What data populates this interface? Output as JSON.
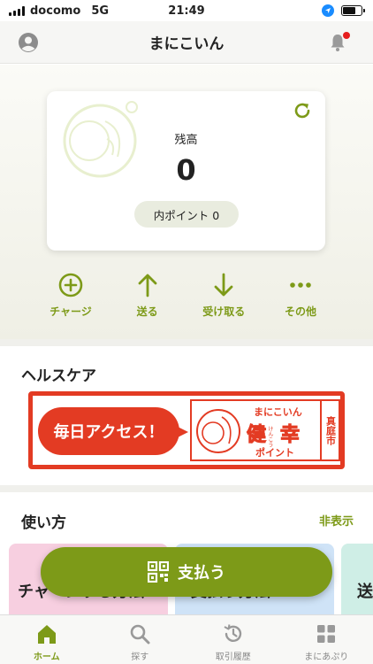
{
  "status_bar": {
    "carrier": "docomo",
    "network": "5G",
    "time": "21:49"
  },
  "header": {
    "title": "まにこいん"
  },
  "balance": {
    "label": "残高",
    "value": "0",
    "points_text": "内ポイント 0"
  },
  "actions": [
    {
      "label": "チャージ",
      "icon": "plus-circle-icon"
    },
    {
      "label": "送る",
      "icon": "arrow-up-icon"
    },
    {
      "label": "受け取る",
      "icon": "arrow-down-icon"
    },
    {
      "label": "その他",
      "icon": "more-dots-icon"
    }
  ],
  "health": {
    "title": "ヘルスケア",
    "banner": {
      "bubble_text": "毎日アクセス！",
      "logo_title": "まにこいん",
      "logo_main_1": "健",
      "logo_main_2": "幸",
      "logo_ruby_1": "けんこう",
      "logo_sub": "ポイント",
      "logo_city": "真庭市"
    }
  },
  "howto": {
    "title": "使い方",
    "hide_label": "非表示",
    "cards": [
      {
        "text": "チャージする方法",
        "color": "#f7cfe0"
      },
      {
        "text": "支払う方法",
        "color": "#cfe3f7"
      },
      {
        "text": "送る方法",
        "color": "#cfeee6"
      }
    ]
  },
  "pay_button": {
    "label": "支払う"
  },
  "tabs": [
    {
      "label": "ホーム",
      "icon": "home-icon",
      "active": true
    },
    {
      "label": "探す",
      "icon": "search-icon",
      "active": false
    },
    {
      "label": "取引履歴",
      "icon": "history-icon",
      "active": false
    },
    {
      "label": "まにあぷり",
      "icon": "apps-icon",
      "active": false
    }
  ],
  "colors": {
    "accent": "#7d9a18",
    "banner_red": "#e33b23"
  }
}
